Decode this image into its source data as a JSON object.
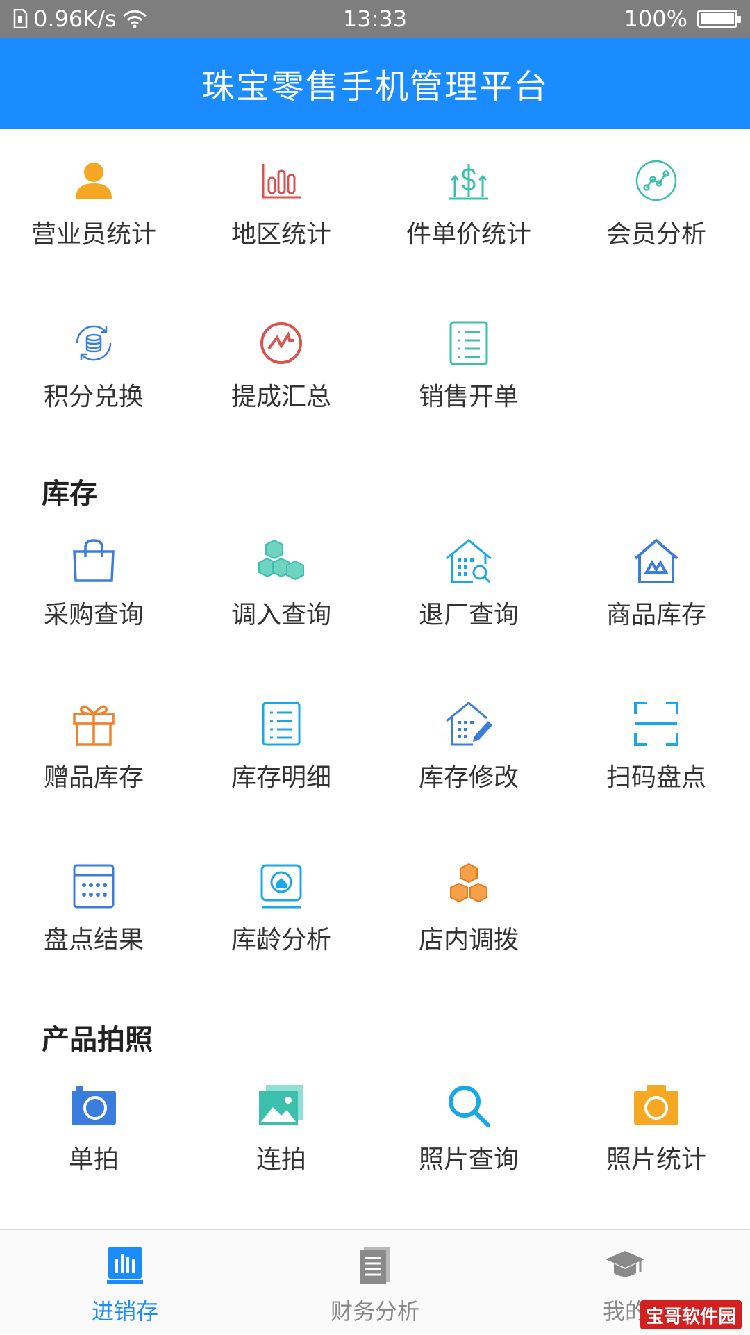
{
  "status_bar": {
    "speed": "0.96K/s",
    "time": "13:33",
    "battery": "100%"
  },
  "header": {
    "title": "珠宝零售手机管理平台"
  },
  "sales_items": [
    {
      "label": "营业员统计",
      "icon": "person-icon",
      "color": "#f5a623"
    },
    {
      "label": "地区统计",
      "icon": "bar-chart-icon",
      "color": "#d9534f"
    },
    {
      "label": "件单价统计",
      "icon": "price-icon",
      "color": "#3cbfad"
    },
    {
      "label": "会员分析",
      "icon": "analytics-icon",
      "color": "#3cbfad"
    },
    {
      "label": "积分兑换",
      "icon": "coin-exchange-icon",
      "color": "#3b7ddd"
    },
    {
      "label": "提成汇总",
      "icon": "trend-circle-icon",
      "color": "#d9534f"
    },
    {
      "label": "销售开单",
      "icon": "list-doc-icon",
      "color": "#3cbfad"
    }
  ],
  "inventory": {
    "title": "库存",
    "items": [
      {
        "label": "采购查询",
        "icon": "shopping-bag-icon",
        "color": "#3b7ddd"
      },
      {
        "label": "调入查询",
        "icon": "cubes-icon",
        "color": "#3cbfad"
      },
      {
        "label": "退厂查询",
        "icon": "house-search-icon",
        "color": "#1aa7e8"
      },
      {
        "label": "商品库存",
        "icon": "house-goods-icon",
        "color": "#3b7ddd"
      },
      {
        "label": "赠品库存",
        "icon": "gift-icon",
        "color": "#f0832a"
      },
      {
        "label": "库存明细",
        "icon": "list-doc-icon",
        "color": "#1aa7e8"
      },
      {
        "label": "库存修改",
        "icon": "house-edit-icon",
        "color": "#3b7ddd"
      },
      {
        "label": "扫码盘点",
        "icon": "scan-icon",
        "color": "#1aa7e8"
      },
      {
        "label": "盘点结果",
        "icon": "calendar-icon",
        "color": "#3b7ddd"
      },
      {
        "label": "库龄分析",
        "icon": "monitor-home-icon",
        "color": "#1aa7e8"
      },
      {
        "label": "店内调拨",
        "icon": "boxes-icon",
        "color": "#f0832a"
      }
    ]
  },
  "photo": {
    "title": "产品拍照",
    "items": [
      {
        "label": "单拍",
        "icon": "camera-icon",
        "color": "#3b7ddd"
      },
      {
        "label": "连拍",
        "icon": "gallery-icon",
        "color": "#3cbfad"
      },
      {
        "label": "照片查询",
        "icon": "search-icon",
        "color": "#1aa7e8"
      },
      {
        "label": "照片统计",
        "icon": "camera-icon",
        "color": "#f7a823"
      }
    ]
  },
  "bottom_nav": [
    {
      "label": "进销存",
      "icon": "bar-chart-icon",
      "active": true
    },
    {
      "label": "财务分析",
      "icon": "document-icon",
      "active": false
    },
    {
      "label": "我的",
      "icon": "graduation-cap-icon",
      "active": false
    }
  ],
  "watermark": "宝哥软件园",
  "colors": {
    "primary": "#1a8cff",
    "status_bar": "#7e7e7e"
  }
}
